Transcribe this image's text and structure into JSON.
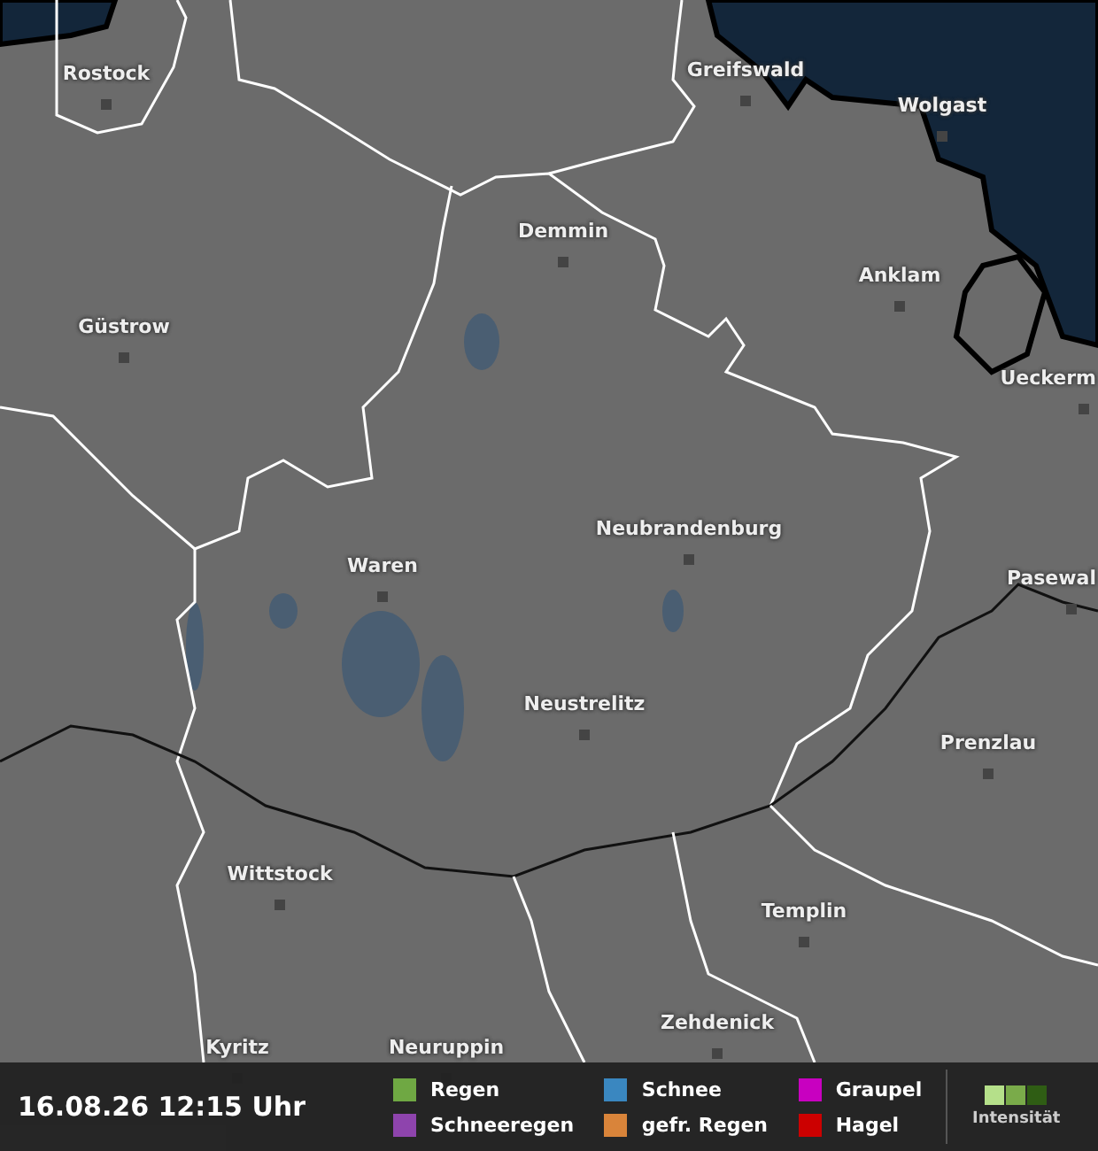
{
  "map": {
    "cities": [
      {
        "name": "Rostock"
      },
      {
        "name": "Greifswald"
      },
      {
        "name": "Wolgast"
      },
      {
        "name": "Demmin"
      },
      {
        "name": "Anklam"
      },
      {
        "name": "Güstrow"
      },
      {
        "name": "Ueckerm"
      },
      {
        "name": "Neubrandenburg"
      },
      {
        "name": "Waren"
      },
      {
        "name": "Pasewal"
      },
      {
        "name": "Neustrelitz"
      },
      {
        "name": "Prenzlau"
      },
      {
        "name": "Wittstock"
      },
      {
        "name": "Templin"
      },
      {
        "name": "Zehdenick"
      },
      {
        "name": "Kyritz"
      },
      {
        "name": "Neuruppin"
      }
    ]
  },
  "legend_bar": {
    "timestamp": "16.08.26 12:15 Uhr",
    "items": [
      {
        "label": "Regen",
        "color": "#6fa843"
      },
      {
        "label": "Schneeregen",
        "color": "#8e44ad"
      },
      {
        "label": "Schnee",
        "color": "#3a87c0"
      },
      {
        "label": "gefr. Regen",
        "color": "#d9843a"
      },
      {
        "label": "Graupel",
        "color": "#c800c0"
      },
      {
        "label": "Hagel",
        "color": "#cc0000"
      }
    ],
    "intensity": {
      "label": "Intensität",
      "levels": [
        {
          "color": "#b5e08a"
        },
        {
          "color": "#7aab4a"
        },
        {
          "color": "#2f5d14"
        }
      ]
    }
  }
}
